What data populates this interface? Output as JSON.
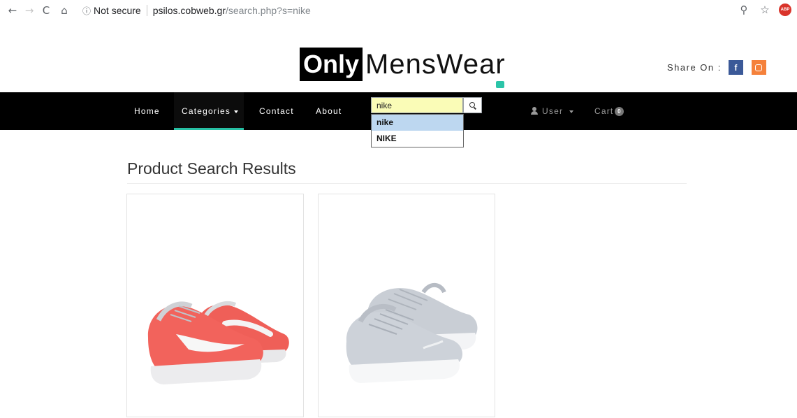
{
  "browser": {
    "back_icon": "←",
    "forward_icon": "→",
    "reload_icon": "C",
    "home_icon": "⌂",
    "info_icon": "ⓘ",
    "security": "Not secure",
    "url_host": "psilos.cobweb.gr",
    "url_path": "/search.php?s=nike",
    "zoom_icon": "⚲",
    "star_icon": "☆",
    "abp_label": "ABP"
  },
  "header": {
    "logo_bold": "Only",
    "logo_rest": "MensWear",
    "share_label": "Share On :",
    "facebook_glyph": "f"
  },
  "nav": {
    "home": "Home",
    "categories": "Categories",
    "contact": "Contact",
    "about": "About",
    "user": "User",
    "cart": "Cart",
    "cart_count": "0"
  },
  "search": {
    "value": "nike",
    "suggestions": [
      "nike",
      "NIKE"
    ]
  },
  "main": {
    "title": "Product Search Results"
  },
  "colors": {
    "accent": "#27c0a4",
    "navbar": "#000000",
    "facebook": "#3b5998",
    "instagram": "#f5813b",
    "search_bg": "#fafcb7",
    "suggest_highlight": "#bdd7f0"
  },
  "products": [
    {
      "image_icon": "sneaker-coral-icon",
      "color": "#f2605b"
    },
    {
      "image_icon": "sneaker-grey-icon",
      "color": "#c7ccd3"
    }
  ]
}
